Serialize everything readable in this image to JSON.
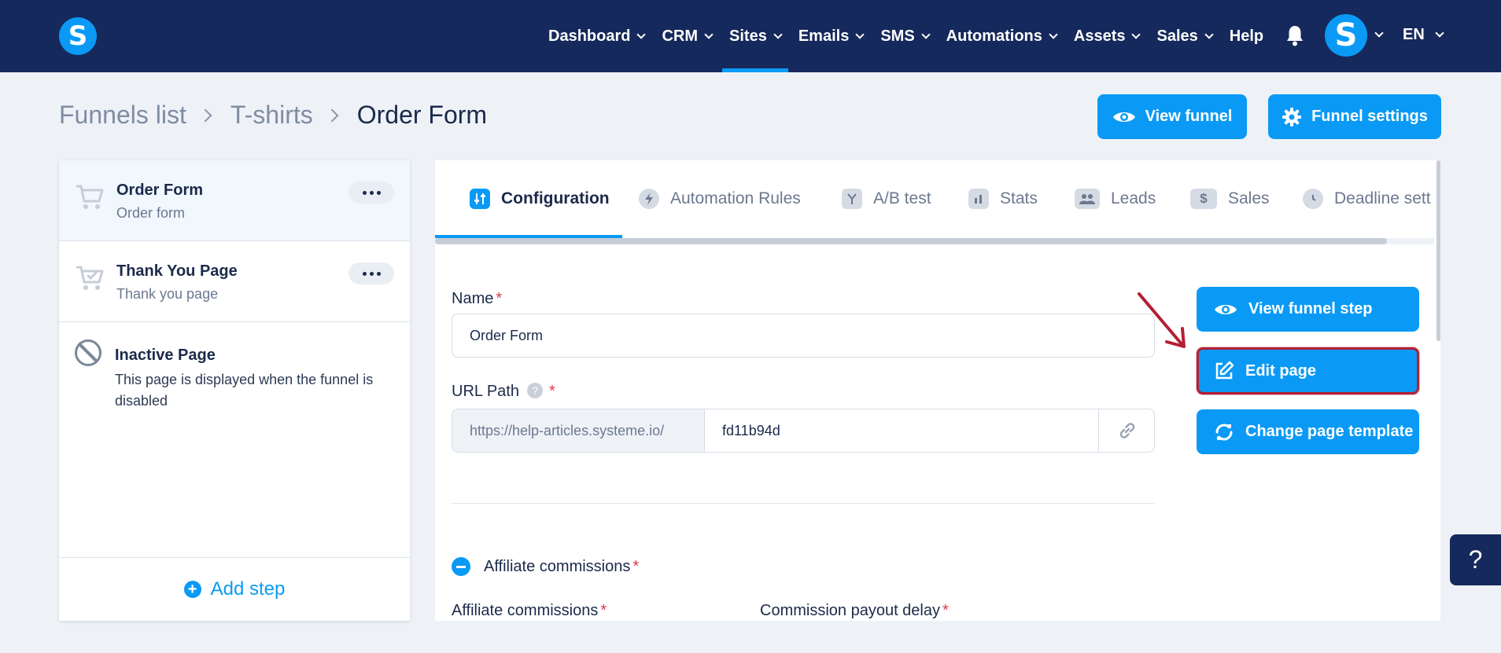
{
  "nav": {
    "items": [
      {
        "label": "Dashboard",
        "has_menu": true,
        "active": false
      },
      {
        "label": "CRM",
        "has_menu": true,
        "active": false
      },
      {
        "label": "Sites",
        "has_menu": true,
        "active": true
      },
      {
        "label": "Emails",
        "has_menu": true,
        "active": false
      },
      {
        "label": "SMS",
        "has_menu": true,
        "active": false
      },
      {
        "label": "Automations",
        "has_menu": true,
        "active": false
      },
      {
        "label": "Assets",
        "has_menu": true,
        "active": false
      },
      {
        "label": "Sales",
        "has_menu": true,
        "active": false
      },
      {
        "label": "Help",
        "has_menu": false,
        "active": false
      }
    ],
    "logo_letter": "S",
    "avatar_letter": "S",
    "language": "EN"
  },
  "breadcrumb": {
    "items": [
      "Funnels list",
      "T-shirts"
    ],
    "current": "Order Form"
  },
  "header": {
    "view_funnel": "View funnel",
    "funnel_settings": "Funnel settings"
  },
  "steps": [
    {
      "title": "Order Form",
      "subtitle": "Order form",
      "active": true
    },
    {
      "title": "Thank You Page",
      "subtitle": "Thank you page",
      "active": false
    }
  ],
  "inactive_page": {
    "title": "Inactive Page",
    "description": "This page is displayed when the funnel is disabled"
  },
  "add_step": "Add step",
  "tabs": [
    {
      "label": "Configuration",
      "icon": "sliders-icon",
      "active": true
    },
    {
      "label": "Automation Rules",
      "icon": "bolt-icon",
      "active": false
    },
    {
      "label": "A/B test",
      "icon": "split-icon",
      "active": false
    },
    {
      "label": "Stats",
      "icon": "bar-chart-icon",
      "active": false
    },
    {
      "label": "Leads",
      "icon": "users-icon",
      "active": false
    },
    {
      "label": "Sales",
      "icon": "dollar-icon",
      "active": false
    },
    {
      "label": "Deadline sett",
      "icon": "clock-icon",
      "active": false
    }
  ],
  "form": {
    "name_label": "Name",
    "name_value": "Order Form",
    "url_label": "URL Path",
    "url_prefix": "https://help-articles.systeme.io/",
    "url_value": "fd11b94d",
    "help_mark": "?",
    "required_mark": "*"
  },
  "side_buttons": {
    "view_step": "View funnel step",
    "edit_page": "Edit page",
    "change_template": "Change page template"
  },
  "affiliate": {
    "section_label": "Affiliate commissions",
    "field_commissions": "Affiliate commissions",
    "field_payout_delay": "Commission payout delay"
  },
  "help_fab": "?",
  "colors": {
    "nav_bg": "#16295c",
    "accent": "#0a9af5",
    "highlight": "#b32034",
    "required": "#e0354b"
  }
}
